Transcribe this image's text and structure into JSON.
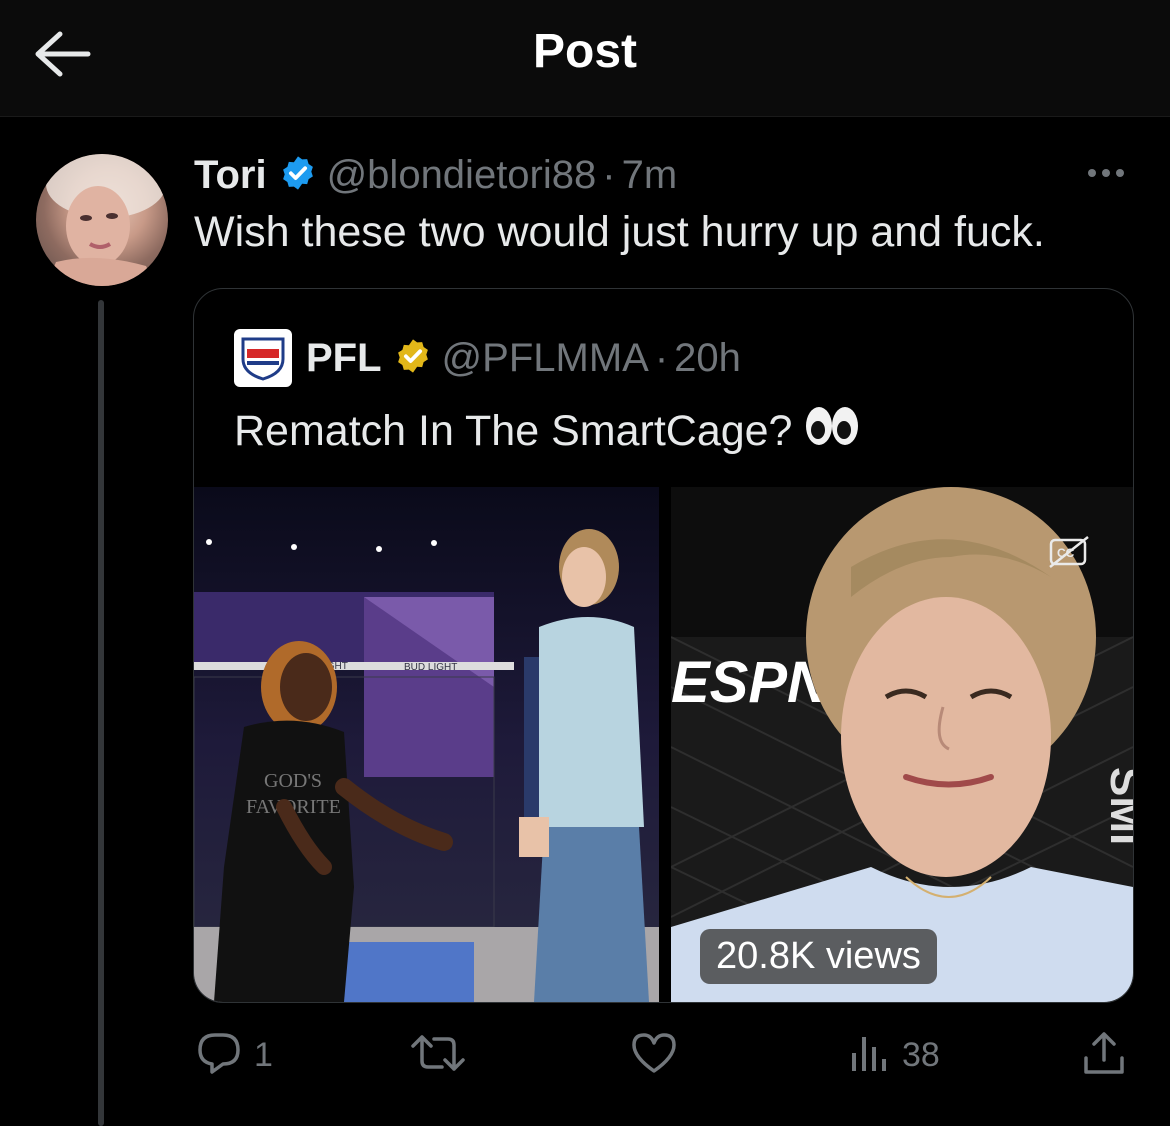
{
  "header": {
    "title": "Post"
  },
  "tweet": {
    "display_name": "Tori",
    "handle": "@blondietori88",
    "separator": "·",
    "time": "7m",
    "text": "Wish these two would just hurry up and fuck."
  },
  "quote": {
    "display_name": "PFL",
    "logo_text": "PFL",
    "handle": "@PFLMMA",
    "separator": "·",
    "time": "20h",
    "text": "Rematch In The SmartCage?",
    "emoji": "👀",
    "views": "20.8K views",
    "media_left_signs": {
      "cage_left": "IGHT",
      "cage_right": "BUD LIGHT",
      "shirt_top": "GOD'S",
      "shirt_bottom": "FAVORITE"
    },
    "media_right_signs": {
      "banner": "ESPN",
      "side": "SMI"
    }
  },
  "actions": {
    "reply_count": "1",
    "retweet_count": "",
    "like_count": "",
    "views_count": "38"
  },
  "colors": {
    "background": "#000000",
    "text": "#e7e9ea",
    "muted": "#71767b",
    "verified_blue": "#1d9bf0",
    "verified_gold": "#e2b719"
  },
  "icons": [
    "back-arrow-icon",
    "verified-badge-icon",
    "gold-verified-badge-icon",
    "more-icon",
    "reply-icon",
    "retweet-icon",
    "like-icon",
    "views-icon",
    "share-icon",
    "captions-icon"
  ]
}
